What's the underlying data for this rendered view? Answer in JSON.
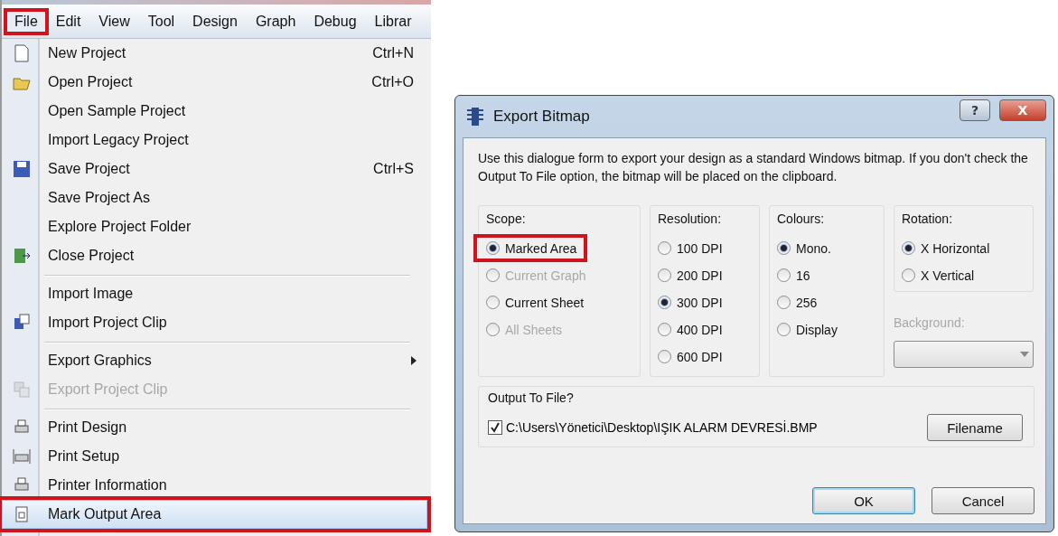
{
  "menu_bar": [
    {
      "label": "File",
      "selected": true,
      "highlighted": true
    },
    {
      "label": "Edit",
      "selected": false,
      "highlighted": false
    },
    {
      "label": "View",
      "selected": false,
      "highlighted": false
    },
    {
      "label": "Tool",
      "selected": false,
      "highlighted": false
    },
    {
      "label": "Design",
      "selected": false,
      "highlighted": false
    },
    {
      "label": "Graph",
      "selected": false,
      "highlighted": false
    },
    {
      "label": "Debug",
      "selected": false,
      "highlighted": false
    },
    {
      "label": "Librar",
      "selected": false,
      "highlighted": false
    }
  ],
  "menu_items": [
    {
      "label": "New Project",
      "shortcut": "Ctrl+N",
      "disabled": false,
      "selected": false,
      "highlighted": false,
      "separator_before": false,
      "submenu": false
    },
    {
      "label": "Open Project",
      "shortcut": "Ctrl+O",
      "disabled": false,
      "selected": false,
      "highlighted": false,
      "separator_before": false,
      "submenu": false
    },
    {
      "label": "Open Sample Project",
      "disabled": false,
      "selected": false,
      "highlighted": false,
      "separator_before": false,
      "submenu": false
    },
    {
      "label": "Import Legacy Project",
      "disabled": false,
      "selected": false,
      "highlighted": false,
      "separator_before": false,
      "submenu": false
    },
    {
      "label": "Save Project",
      "shortcut": "Ctrl+S",
      "disabled": false,
      "selected": false,
      "highlighted": false,
      "separator_before": false,
      "submenu": false
    },
    {
      "label": "Save Project As",
      "disabled": false,
      "selected": false,
      "highlighted": false,
      "separator_before": false,
      "submenu": false
    },
    {
      "label": "Explore Project Folder",
      "disabled": false,
      "selected": false,
      "highlighted": false,
      "separator_before": false,
      "submenu": false
    },
    {
      "label": "Close Project",
      "disabled": false,
      "selected": false,
      "highlighted": false,
      "separator_before": false,
      "submenu": false
    },
    {
      "label": "Import Image",
      "disabled": false,
      "selected": false,
      "highlighted": false,
      "separator_before": true,
      "submenu": false
    },
    {
      "label": "Import Project Clip",
      "disabled": false,
      "selected": false,
      "highlighted": false,
      "separator_before": false,
      "submenu": false
    },
    {
      "label": "Export Graphics",
      "disabled": false,
      "selected": false,
      "highlighted": false,
      "separator_before": true,
      "submenu": true
    },
    {
      "label": "Export Project Clip",
      "disabled": true,
      "selected": false,
      "highlighted": false,
      "separator_before": false,
      "submenu": false
    },
    {
      "label": "Print Design",
      "disabled": false,
      "selected": false,
      "highlighted": false,
      "separator_before": true,
      "submenu": false
    },
    {
      "label": "Print Setup",
      "disabled": false,
      "selected": false,
      "highlighted": false,
      "separator_before": false,
      "submenu": false
    },
    {
      "label": "Printer Information",
      "disabled": false,
      "selected": false,
      "highlighted": false,
      "separator_before": false,
      "submenu": false
    },
    {
      "label": "Mark Output Area",
      "disabled": false,
      "selected": true,
      "highlighted": true,
      "separator_before": false,
      "submenu": false
    }
  ],
  "dialog": {
    "title": "Export Bitmap",
    "help": "?",
    "close": "X",
    "description": "Use this dialogue form to export your design as a standard Windows bitmap. If you don't check the Output To File option, the bitmap will be placed on the clipboard.",
    "groups": [
      {
        "title": "Scope:",
        "options": [
          {
            "label": "Marked Area",
            "selected": true,
            "disabled": false,
            "highlighted": true
          },
          {
            "label": "Current Graph",
            "selected": false,
            "disabled": true,
            "highlighted": false
          },
          {
            "label": "Current Sheet",
            "selected": false,
            "disabled": false,
            "highlighted": false
          },
          {
            "label": "All Sheets",
            "selected": false,
            "disabled": true,
            "highlighted": false
          }
        ]
      },
      {
        "title": "Resolution:",
        "options": [
          {
            "label": "100 DPI",
            "selected": false,
            "disabled": false,
            "highlighted": false
          },
          {
            "label": "200 DPI",
            "selected": false,
            "disabled": false,
            "highlighted": false
          },
          {
            "label": "300 DPI",
            "selected": true,
            "disabled": false,
            "highlighted": false
          },
          {
            "label": "400 DPI",
            "selected": false,
            "disabled": false,
            "highlighted": false
          },
          {
            "label": "600 DPI",
            "selected": false,
            "disabled": false,
            "highlighted": false
          }
        ]
      },
      {
        "title": "Colours:",
        "options": [
          {
            "label": "Mono.",
            "selected": true,
            "disabled": false,
            "highlighted": false
          },
          {
            "label": "16",
            "selected": false,
            "disabled": false,
            "highlighted": false
          },
          {
            "label": "256",
            "selected": false,
            "disabled": false,
            "highlighted": false
          },
          {
            "label": "Display",
            "selected": false,
            "disabled": false,
            "highlighted": false
          }
        ]
      },
      {
        "title": "Rotation:",
        "options": [
          {
            "label": "X Horizontal",
            "selected": true,
            "disabled": false,
            "highlighted": false
          },
          {
            "label": "X Vertical",
            "selected": false,
            "disabled": false,
            "highlighted": false
          }
        ]
      }
    ],
    "background": {
      "label": "Background:",
      "disabled": true
    },
    "output": {
      "title": "Output To File?",
      "checked": true,
      "path": "C:\\Users\\Yönetici\\Desktop\\IŞIK ALARM DEVRESİ.BMP",
      "button": "Filename"
    },
    "buttons": [
      {
        "label": "OK",
        "default": true
      },
      {
        "label": "Cancel",
        "default": false
      }
    ]
  }
}
